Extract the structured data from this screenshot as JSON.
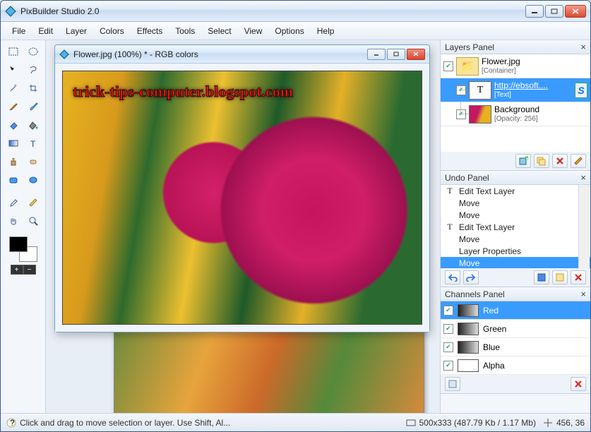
{
  "app": {
    "title": "PixBuilder Studio 2.0"
  },
  "menu": {
    "items": [
      "File",
      "Edit",
      "Layer",
      "Colors",
      "Effects",
      "Tools",
      "Select",
      "View",
      "Options",
      "Help"
    ]
  },
  "doc": {
    "title": "Flower.jpg (100%) * - RGB colors",
    "watermark": "trick-tips-computer.blogspot.com"
  },
  "layers_panel": {
    "title": "Layers Panel",
    "items": [
      {
        "name": "Flower.jpg",
        "meta": "[Container]",
        "selected": false,
        "thumb": "folder"
      },
      {
        "name": "http://ebsoft....",
        "meta": "[Text]",
        "selected": true,
        "thumb": "T",
        "side": "S"
      },
      {
        "name": "Background",
        "meta": "[Opacity: 256]",
        "selected": false,
        "thumb": "img"
      }
    ]
  },
  "undo_panel": {
    "title": "Undo Panel",
    "items": [
      {
        "label": "Edit Text Layer",
        "icon": "T"
      },
      {
        "label": "Move"
      },
      {
        "label": "Move"
      },
      {
        "label": "Edit Text Layer",
        "icon": "T"
      },
      {
        "label": "Move"
      },
      {
        "label": "Layer Properties"
      },
      {
        "label": "Move",
        "selected": true
      }
    ]
  },
  "channels_panel": {
    "title": "Channels Panel",
    "items": [
      {
        "label": "Red",
        "selected": true
      },
      {
        "label": "Green"
      },
      {
        "label": "Blue"
      },
      {
        "label": "Alpha",
        "alpha": true
      }
    ]
  },
  "status": {
    "hint": "Click and drag to move selection or layer. Use Shift, Al...",
    "dims": "500x333  (487.79 Kb / 1.17 Mb)",
    "coords": "456, 36"
  }
}
